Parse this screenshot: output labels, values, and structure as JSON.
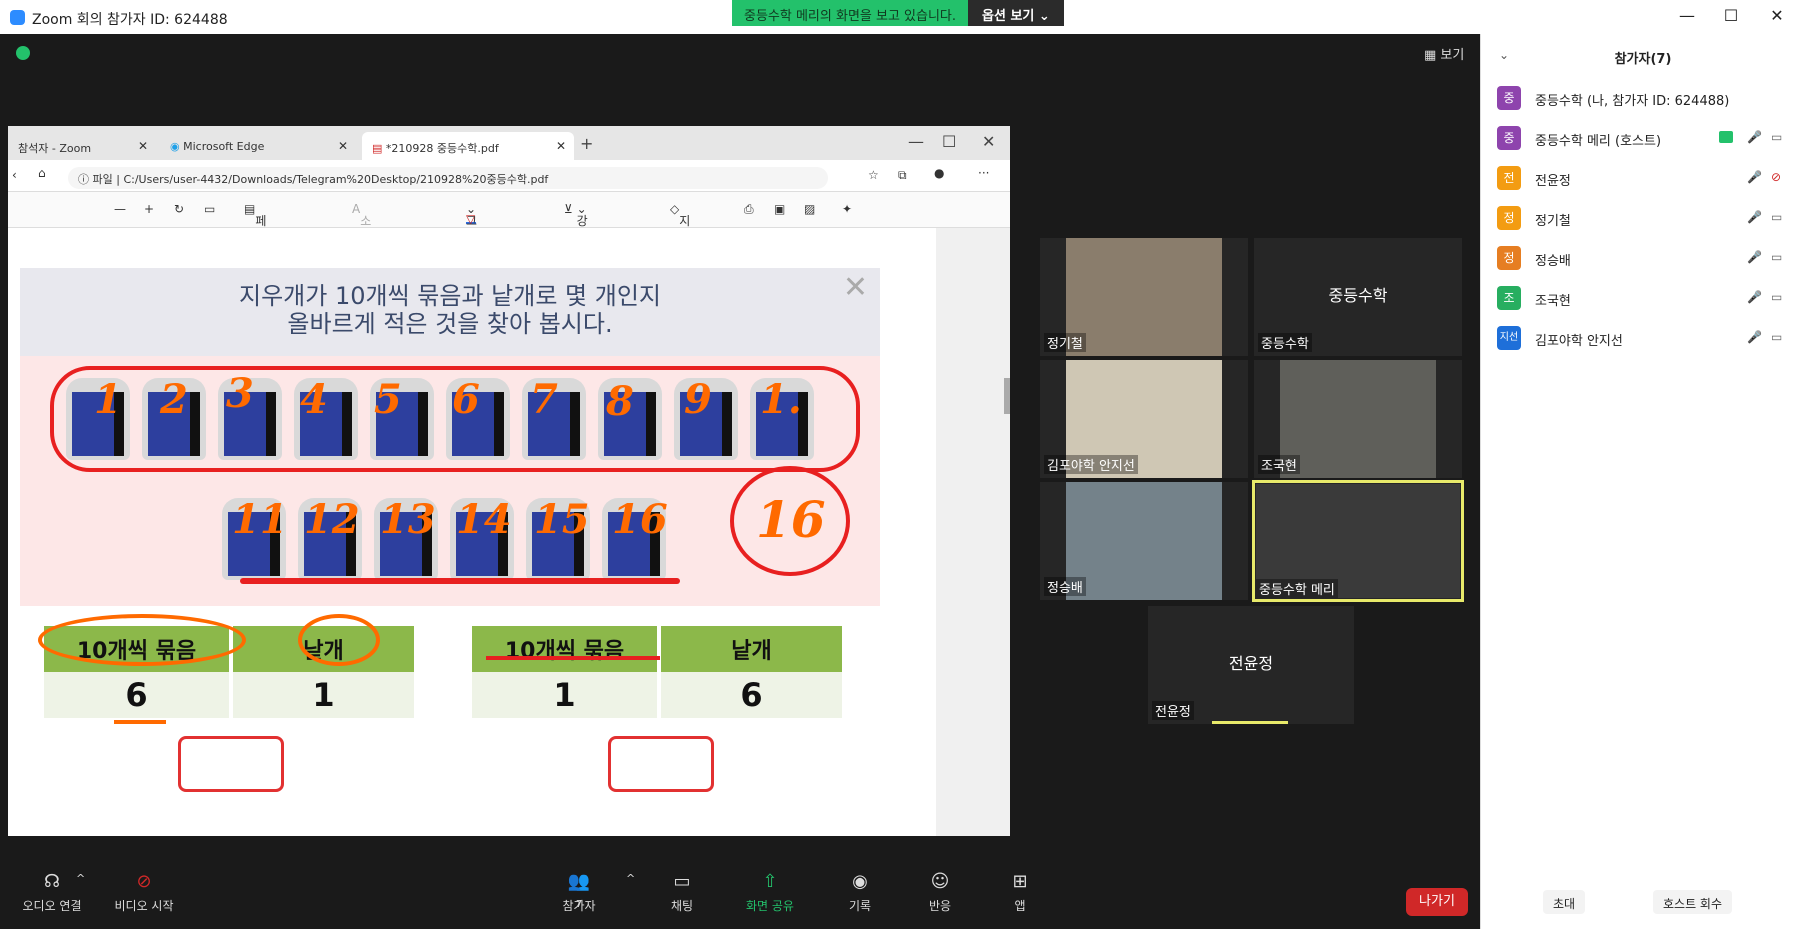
{
  "window": {
    "title": "Zoom 회의 참가자 ID: 624488"
  },
  "share_banner": {
    "message": "중등수학 메리의 화면을 보고 있습니다.",
    "options": "옵션 보기 ⌄"
  },
  "view_button": "보기",
  "browser": {
    "tabs": [
      {
        "label": "참석자 - Zoom",
        "active": false
      },
      {
        "label": "Microsoft Edge",
        "active": false
      },
      {
        "label": "*210928 중등수학.pdf",
        "active": true
      }
    ],
    "file_label": "파일",
    "url": "C:/Users/user-4432/Downloads/Telegram%20Desktop/210928%20중등수학.pdf",
    "pdf_toolbar": {
      "page_view": "페이지 보기",
      "read_aloud": "소리내어 읽기",
      "draw": "그리기",
      "highlight": "강조 표시",
      "erase": "지우기"
    },
    "question_line1": "지우개가 10개씩 묶음과 낱개로 몇 개인지",
    "question_line2": "올바르게 적은 것을 찾아 봅시다.",
    "annotations": [
      "1",
      "2",
      "3",
      "4",
      "5",
      "6",
      "7",
      "8",
      "9",
      "1.",
      "11",
      "12",
      "13",
      "14",
      "15",
      "16",
      "16"
    ],
    "table_left": {
      "col1": "10개씩 묶음",
      "col2": "낱개",
      "val1": "6",
      "val2": "1"
    },
    "table_right": {
      "col1": "10개씩 묶음",
      "col2": "낱개",
      "val1": "1",
      "val2": "6"
    }
  },
  "video_tiles": [
    {
      "name": "정기철",
      "video": true
    },
    {
      "name": "중등수학",
      "video": false,
      "center_name": "중등수학"
    },
    {
      "name": "김포야학 안지선",
      "video": true
    },
    {
      "name": "조국현",
      "video": true
    },
    {
      "name": "정승배",
      "video": true
    },
    {
      "name": "중등수학 메리",
      "video": true,
      "speaking": true
    },
    {
      "name": "전윤정",
      "video": false,
      "center_name": "전윤정"
    }
  ],
  "toolbar": {
    "audio": "오디오 연결",
    "video": "비디오 시작",
    "participants": "참가자",
    "participants_count": "7",
    "chat": "채팅",
    "share": "화면 공유",
    "record": "기록",
    "reactions": "반응",
    "apps": "앱",
    "leave": "나가기"
  },
  "panel": {
    "title": "참가자(7)",
    "participants": [
      {
        "initial": "중",
        "color": "#8e44ad",
        "name": "중등수학 (나, 참가자 ID: 624488)",
        "mic": "",
        "cam": ""
      },
      {
        "initial": "중",
        "color": "#8e44ad",
        "name": "중등수학 메리 (호스트)",
        "sharing": true,
        "mic": "🎤",
        "cam": "▭"
      },
      {
        "initial": "전",
        "color": "#f39c12",
        "name": "전윤정",
        "mic": "🎤",
        "cam": "⊘"
      },
      {
        "initial": "정",
        "color": "#f39c12",
        "name": "정기철",
        "mic": "🎤",
        "cam": "▭"
      },
      {
        "initial": "정",
        "color": "#e67e22",
        "name": "정승배",
        "mic": "🎤",
        "cam": "▭"
      },
      {
        "initial": "조",
        "color": "#27ae60",
        "name": "조국현",
        "mic": "🎤",
        "cam": "▭"
      },
      {
        "initial": "지선",
        "color": "#1e6fd9",
        "name": "김포야학 안지선",
        "mic": "🎤",
        "cam": "▭"
      }
    ],
    "invite": "초대",
    "reclaim_host": "호스트 회수"
  }
}
